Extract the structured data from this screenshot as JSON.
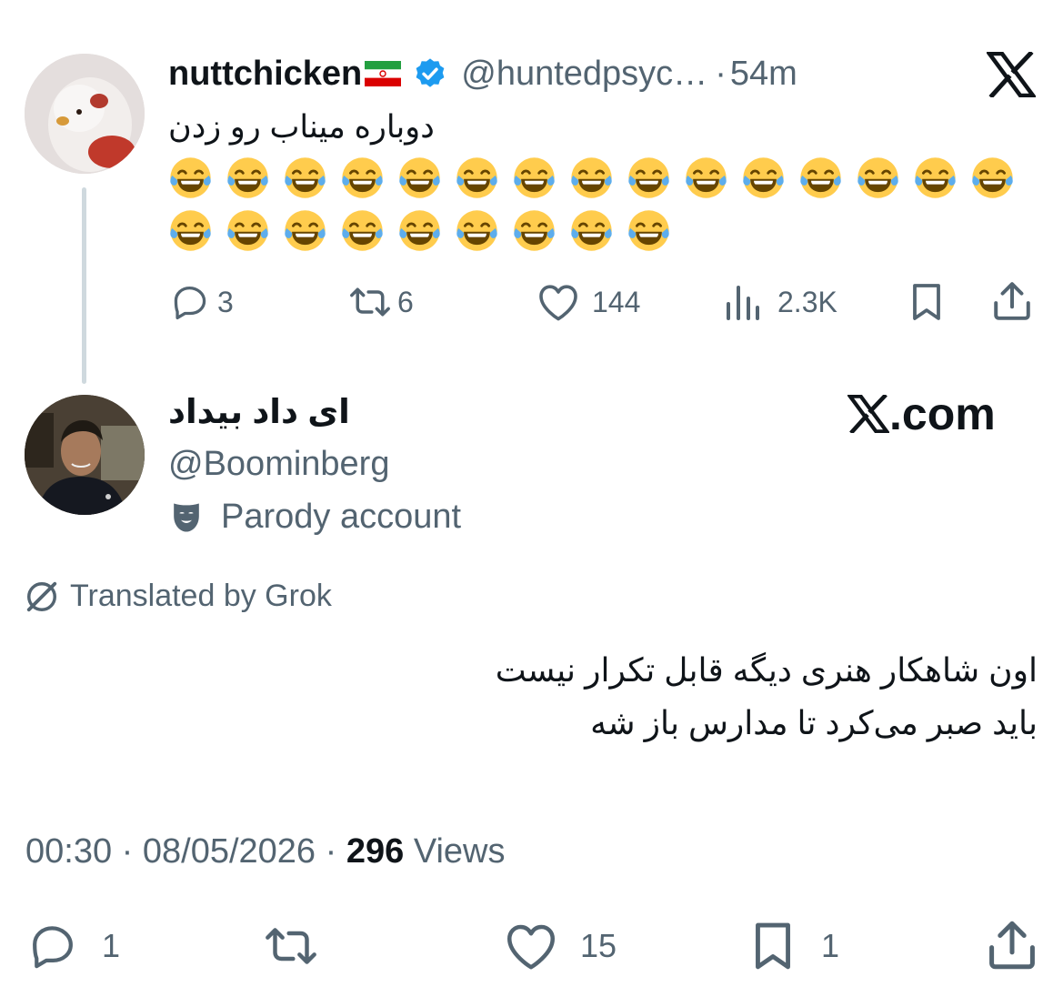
{
  "parent_tweet": {
    "display_name": "nuttchicken",
    "handle": "@huntedpsyc…",
    "separator": "·",
    "time": "54m",
    "text": "دوباره میناب رو زدن",
    "emoji_rows": [
      15,
      9
    ],
    "emoji_name": "face-with-tears-of-joy",
    "actions": {
      "replies": "3",
      "reposts": "6",
      "likes": "144",
      "views": "2.3K"
    }
  },
  "reply_tweet": {
    "display_name": "ای داد بیداد",
    "handle": "@Boominberg",
    "parody_label": "Parody account",
    "translated_label": "Translated by Grok",
    "text_lines": [
      "اون شاهکار هنری دیگه قابل تکرار نیست",
      "باید صبر می‌کرد تا مدارس باز شه"
    ],
    "time": "00:30",
    "date": "08/05/2026",
    "dot": "·",
    "views_count": "296",
    "views_label": "Views",
    "actions": {
      "replies": "1",
      "likes": "15",
      "bookmarks": "1"
    }
  },
  "watermark": {
    "logo": "x-logo",
    "text": ".com"
  },
  "colors": {
    "text": "#0f1419",
    "secondary": "#536471",
    "verified": "#1d9bf0",
    "thread_line": "#cfd9de"
  }
}
